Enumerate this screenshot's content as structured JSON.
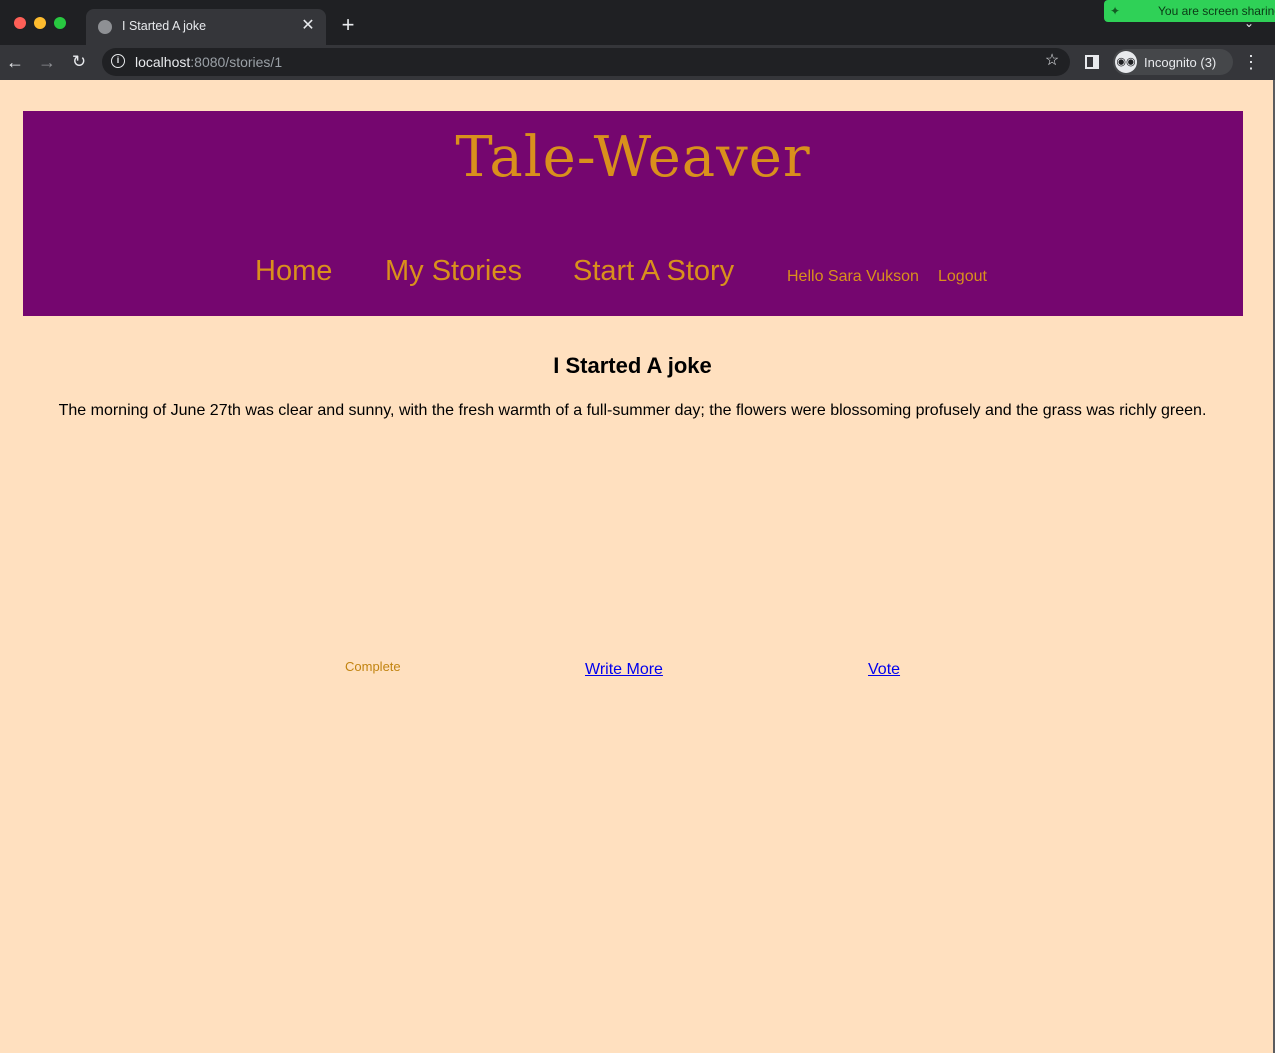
{
  "browser": {
    "tab_title": "I Started A joke",
    "close_glyph": "✕",
    "new_tab_glyph": "+",
    "tab_search_glyph": "⌄",
    "screen_share_text": "You are screen sharing",
    "url_host": "localhost",
    "url_rest": ":8080/stories/1",
    "incognito_label": "Incognito (3)",
    "back_glyph": "←",
    "forward_glyph": "→",
    "reload_glyph": "↻",
    "info_glyph": "i",
    "star_glyph": "☆",
    "menu_glyph": "⋮",
    "incognito_glyph": "◉◉",
    "share_glyph": "✦"
  },
  "site": {
    "logo": "Tale-Weaver",
    "nav": {
      "home": "Home",
      "my_stories": "My Stories",
      "start_story": "Start A Story",
      "greeting": "Hello Sara Vukson",
      "logout": "Logout"
    }
  },
  "story": {
    "title": "I Started A joke",
    "body": "The morning of June 27th was clear and sunny, with the fresh warmth of a full-summer day; the flowers were blossoming profusely and the grass was richly green.",
    "actions": {
      "complete": "Complete",
      "write_more": "Write More",
      "vote": "Vote"
    }
  },
  "colors": {
    "header_bg": "#75066f",
    "accent": "#d9901c",
    "page_bg": "#ffe0bf",
    "link": "#0000ee"
  }
}
